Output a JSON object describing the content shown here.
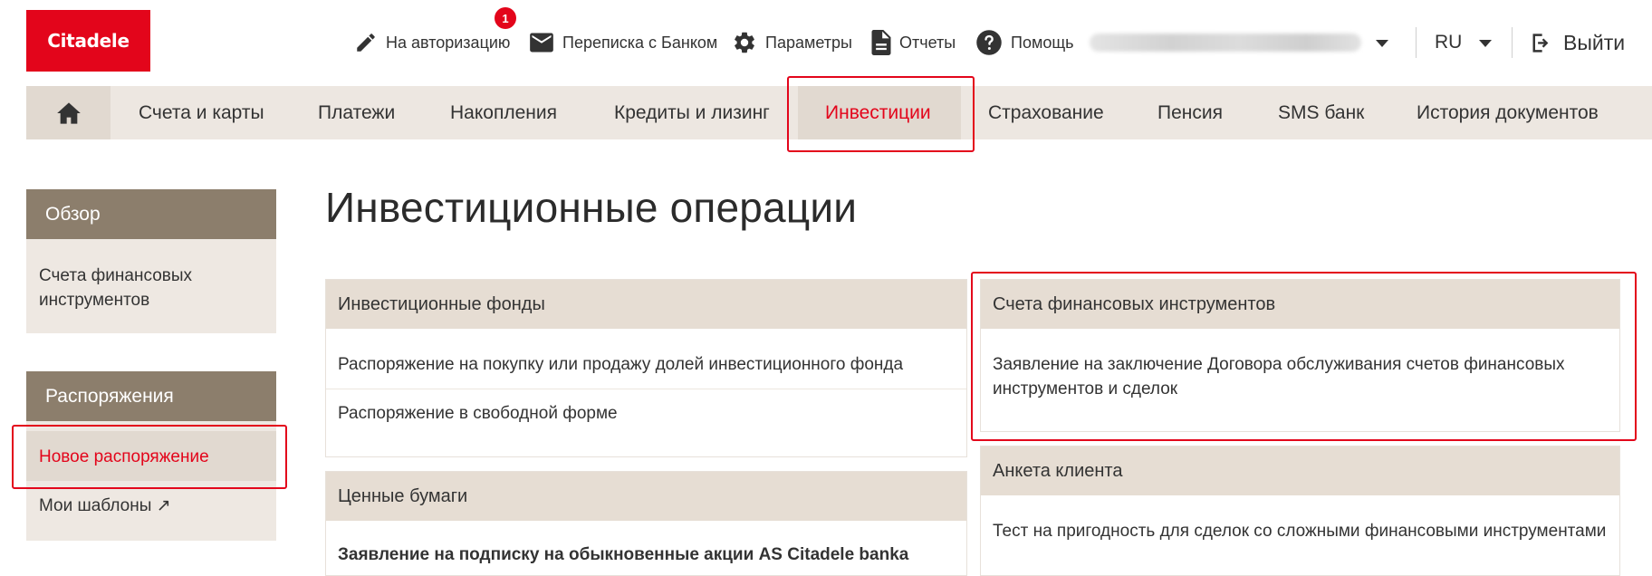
{
  "brand": {
    "logo_text": "Citadele",
    "accent": "#e3051b"
  },
  "header": {
    "authorize_label": "На авторизацию",
    "authorize_badge": "1",
    "messages_label": "Переписка с Банком",
    "settings_label": "Параметры",
    "reports_label": "Отчеты",
    "help_label": "Помощь",
    "language": "RU",
    "logout_label": "Выйти"
  },
  "nav": {
    "items": [
      {
        "label": "Счета и карты"
      },
      {
        "label": "Платежи"
      },
      {
        "label": "Накопления"
      },
      {
        "label": "Кредиты и лизинг"
      },
      {
        "label": "Инвестиции",
        "active": true
      },
      {
        "label": "Страхование"
      },
      {
        "label": "Пенсия"
      },
      {
        "label": "SMS банк"
      },
      {
        "label": "История документов"
      }
    ]
  },
  "sidebar": {
    "overview_title": "Обзор",
    "overview_items": [
      {
        "label": "Счета финансовых инструментов"
      }
    ],
    "orders_title": "Распоряжения",
    "orders_items": [
      {
        "label": "Новое распоряжение",
        "selected": true
      },
      {
        "label": "Мои шаблоны ↗"
      }
    ]
  },
  "main": {
    "title": "Инвестиционные операции",
    "cards": [
      {
        "title": "Инвестиционные фонды",
        "links": [
          "Распоряжение на покупку или продажу долей инвестиционного фонда",
          "Распоряжение в свободной форме"
        ]
      },
      {
        "title": "Ценные бумаги",
        "links": [
          "Заявление на подписку на обыкновенные акции AS Citadele banka"
        ]
      },
      {
        "title": "Счета финансовых инструментов",
        "links": [
          "Заявление на заключение Договора обслуживания счетов финансовых инструментов и сделок"
        ]
      },
      {
        "title": "Анкета клиента",
        "links": [
          "Тест на пригодность для сделок со сложными финансовыми инструментами"
        ]
      }
    ]
  }
}
